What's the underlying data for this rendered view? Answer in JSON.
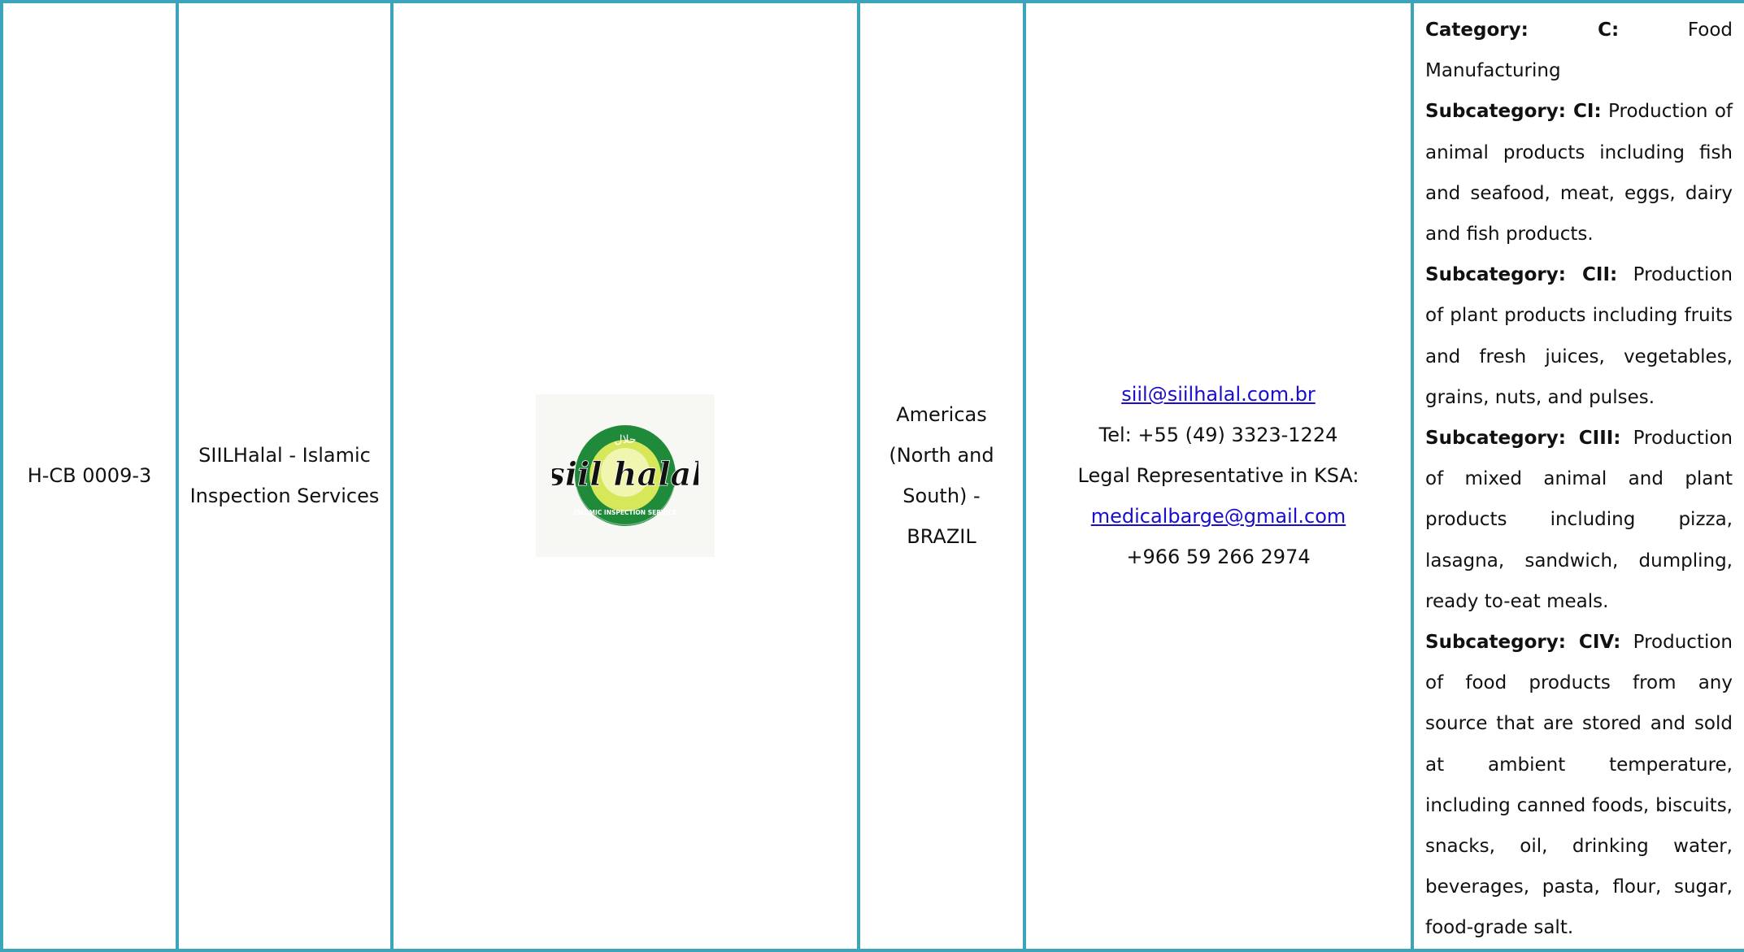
{
  "row": {
    "code": "H-CB 0009-3",
    "name_line1": "SIILHalal - Islamic",
    "name_line2": "Inspection Services",
    "logo": {
      "icon": "siilhalal-logo",
      "wordmark": "siil halal",
      "ring_text": "ISLAMIC INSPECTION SERVICE",
      "arabic_text": "حلال",
      "colors": {
        "ring": "#1f8a3a",
        "inner": "#d6e85a",
        "text": "#111111"
      }
    },
    "region_lines": [
      "Americas",
      "(North and",
      "South) -",
      "BRAZIL"
    ],
    "contact": {
      "email": "siil@siilhalal.com.br",
      "tel": "Tel: +55 (49) 3323-1224",
      "legal_rep": "Legal Representative in KSA:",
      "legal_email": "medicalbarge@gmail.com",
      "legal_phone": "+966 59 266 2974"
    },
    "categories": [
      {
        "label": "Category: C:",
        "text": " Food Manufacturing"
      },
      {
        "label": "Subcategory: CI:",
        "text": " Production of animal products including fish and seafood, meat, eggs, dairy and fish products."
      },
      {
        "label": "Subcategory: CII:",
        "text": " Production of plant products including fruits and fresh juices, vegetables, grains, nuts, and pulses."
      },
      {
        "label": "Subcategory: CIII:",
        "text": " Production of mixed animal and plant products including pizza, lasagna, sandwich, dumpling, ready to-eat meals."
      },
      {
        "label": "Subcategory: CIV:",
        "text": " Production of food products from any source that are stored and sold at ambient temperature, including canned foods, biscuits, snacks, oil, drinking water, beverages, pasta, flour, sugar, food-grade salt."
      }
    ],
    "border_color": "#3ba4b8",
    "link_color": "#1a0dcc"
  }
}
